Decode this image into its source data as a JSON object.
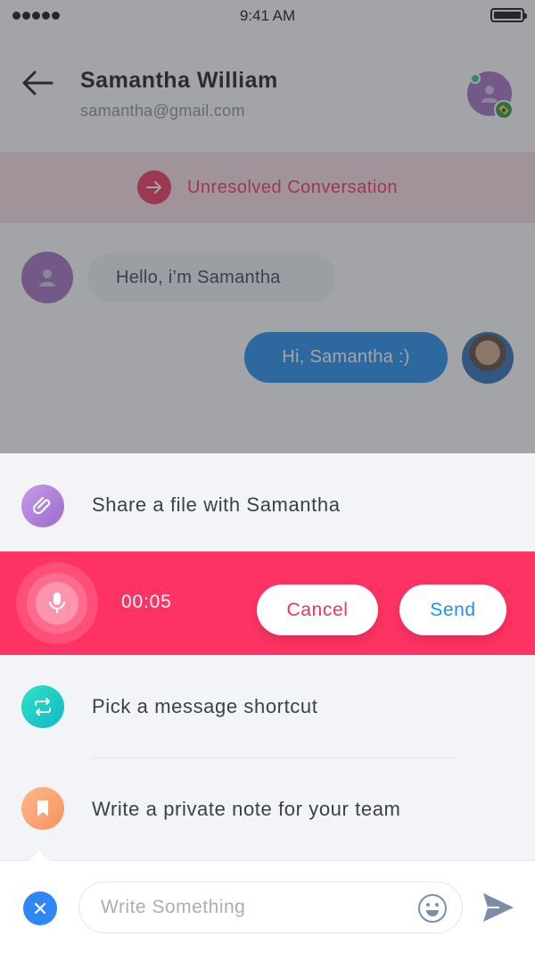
{
  "status_bar": {
    "time": "9:41 AM"
  },
  "header": {
    "name": "Samantha William",
    "email": "samantha@gmail.com"
  },
  "banner": {
    "label": "Unresolved Conversation"
  },
  "messages": [
    {
      "direction": "incoming",
      "text": "Hello, i’m Samantha"
    },
    {
      "direction": "outgoing",
      "text": "Hi, Samantha :)"
    }
  ],
  "sheet": {
    "share_file_label": "Share a file with Samantha",
    "recording": {
      "time": "00:05",
      "cancel_label": "Cancel",
      "send_label": "Send"
    },
    "shortcut_label": "Pick a message shortcut",
    "note_label": "Write a private note for your team"
  },
  "composer": {
    "placeholder": "Write Something",
    "value": ""
  },
  "icons": {
    "back": "arrow-left-icon",
    "unresolved": "arrow-right-icon",
    "file": "paperclip-icon",
    "mic": "microphone-icon",
    "shortcut": "repeat-icon",
    "note": "bookmark-icon",
    "close": "close-icon",
    "emoji": "smiley-icon",
    "send": "send-icon"
  },
  "colors": {
    "accent_red": "#fe3363",
    "accent_blue": "#1f8ff0",
    "sheet_bg": "#f3f4f7",
    "banner_bg": "#fbe1e7"
  }
}
